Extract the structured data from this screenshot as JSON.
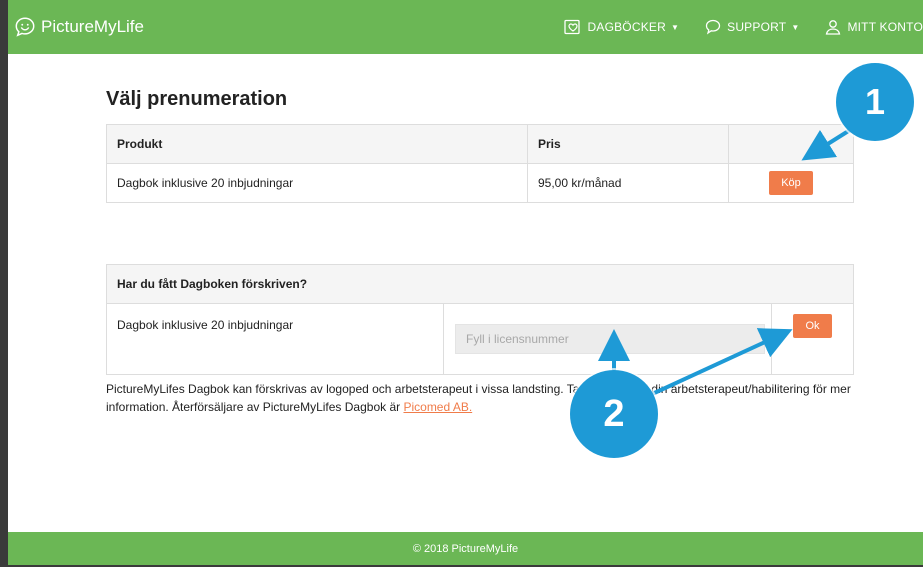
{
  "brand": {
    "name": "PictureMyLife",
    "logo_icon": "smiley-speech-icon"
  },
  "nav": {
    "diaries": {
      "label": "DAGBÖCKER",
      "icon": "diary-heart-icon"
    },
    "support": {
      "label": "SUPPORT",
      "icon": "chat-bubble-icon"
    },
    "account": {
      "label": "MITT KONTO",
      "icon": "user-icon"
    }
  },
  "page": {
    "title": "Välj prenumeration"
  },
  "subscription_table": {
    "headers": {
      "product": "Produkt",
      "price": "Pris"
    },
    "row": {
      "product": "Dagbok inklusive 20 inbjudningar",
      "price": "95,00 kr/månad",
      "buy_label": "Köp"
    }
  },
  "license_table": {
    "header": "Har du fått Dagboken förskriven?",
    "row": {
      "product": "Dagbok inklusive 20 inbjudningar",
      "placeholder": "Fyll i licensnummer",
      "ok_label": "Ok"
    }
  },
  "info": {
    "text_before": "PictureMyLifes Dagbok kan förskrivas av logoped och arbetsterapeut i vissa landsting. Ta kontakt med din arbetsterapeut/habilitering för mer information. Återförsäljare av PictureMyLifes Dagbok är ",
    "link": "Picomed AB."
  },
  "footer": {
    "text": "© 2018 PictureMyLife"
  },
  "annotations": {
    "badge1": "1",
    "badge2": "2"
  },
  "colors": {
    "header_green": "#6bb755",
    "button_orange": "#f07c4a",
    "badge_blue": "#1e9ad6"
  }
}
